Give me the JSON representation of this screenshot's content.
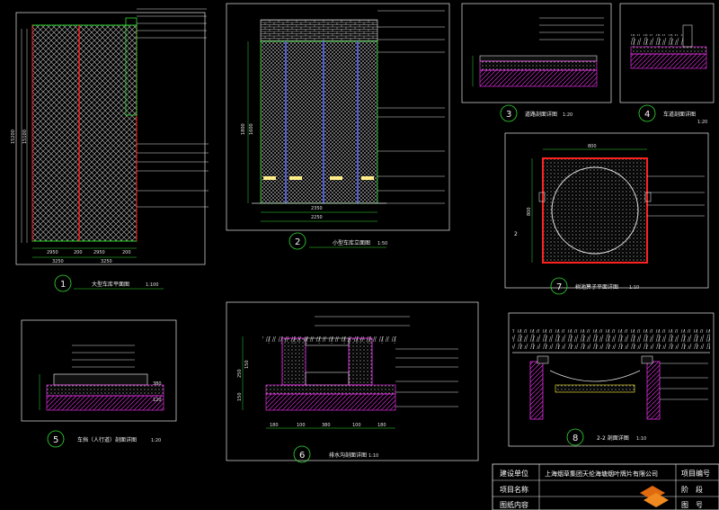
{
  "drawing": {
    "frame_color": "#e6e6e6",
    "accent_red": "#ff2020",
    "line_green": "#33dd33",
    "line_magenta": "#ff33ff",
    "line_cyan": "#33dddd",
    "label_yellow": "#ffee33"
  },
  "views": {
    "v1": {
      "number": "1",
      "title": "大型车库平面图",
      "scale": "1:100",
      "dims": [
        "2950",
        "200",
        "2950",
        "200",
        "3250",
        "3250"
      ],
      "heights": [
        "15200",
        "15100"
      ]
    },
    "v2": {
      "number": "2",
      "title": "小型车库立面图",
      "scale": "1:50",
      "dims": [
        "2350",
        "2250"
      ],
      "heights": [
        "1800",
        "1600"
      ]
    },
    "v3": {
      "number": "3",
      "title": "道路剖面详图",
      "scale": "1:20"
    },
    "v4": {
      "number": "4",
      "title": "车道剖面详图",
      "scale": "1:20"
    },
    "v5": {
      "number": "5",
      "title": "车挡（人行道）剖面详图",
      "scale": "1:20",
      "dims": [
        "380",
        "120"
      ]
    },
    "v6": {
      "number": "6",
      "title": "排水沟剖面详图",
      "scale": "1:10",
      "dims": [
        "180",
        "100",
        "380",
        "100",
        "180"
      ],
      "heights": [
        "250",
        "150",
        "150"
      ]
    },
    "v7": {
      "number": "7",
      "title": "树池箅子平面详图",
      "scale": "1:10",
      "dims": [
        "800",
        "800"
      ],
      "side": "2"
    },
    "v8": {
      "number": "8",
      "title": "2-2 剖面详图",
      "scale": "1:10"
    }
  },
  "title_block": {
    "row1_label": "建设单位",
    "row1_value": "上海烟草集团天伦海塘烟叶牌片有限公司",
    "row1_right": "项目编号",
    "row2_label": "项目名称",
    "row2_right": "阶　段",
    "row3_label": "图纸内容",
    "row3_right": "图　号"
  }
}
